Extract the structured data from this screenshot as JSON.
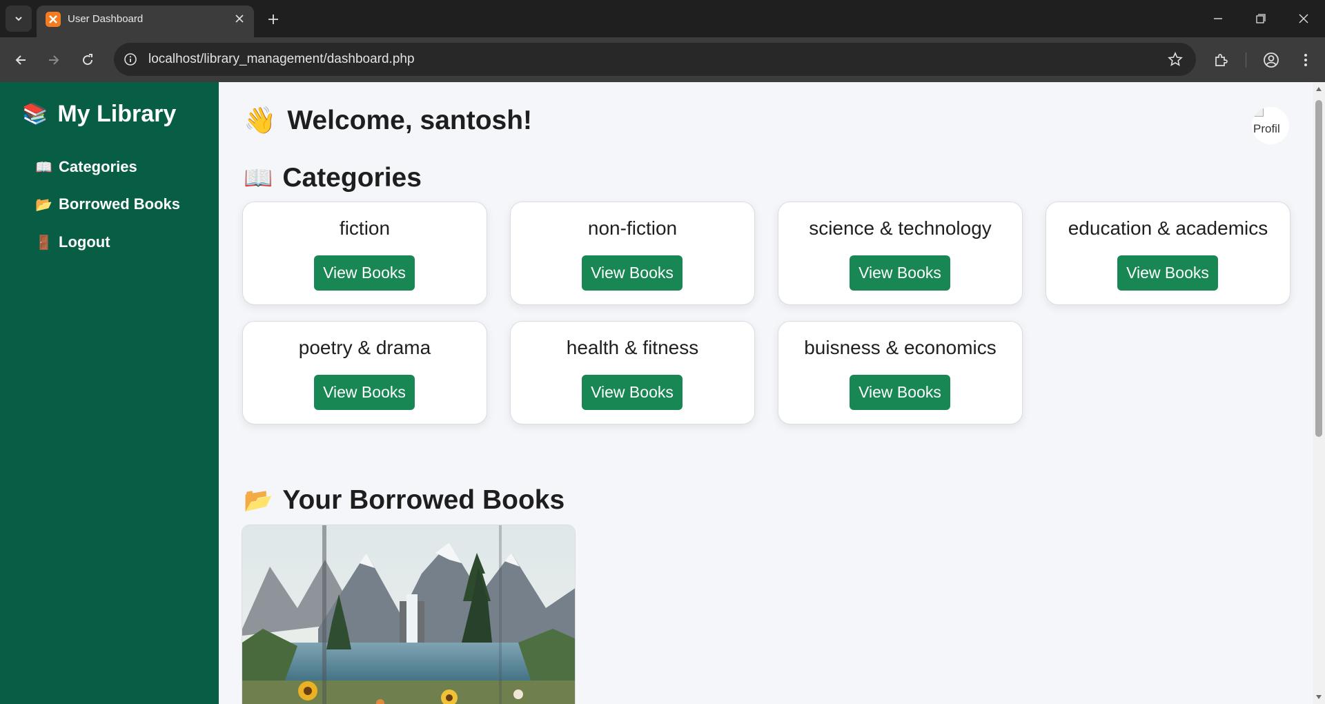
{
  "browser": {
    "tab_title": "User Dashboard",
    "url": "localhost/library_management/dashboard.php"
  },
  "sidebar": {
    "brand_icon": "📚",
    "brand": "My Library",
    "items": [
      {
        "icon": "📖",
        "label": "Categories"
      },
      {
        "icon": "📂",
        "label": "Borrowed Books"
      },
      {
        "icon": "🚪",
        "label": "Logout"
      }
    ]
  },
  "main": {
    "welcome_emoji": "👋",
    "welcome": "Welcome, santosh!",
    "profile_alt": "Profil",
    "categories_emoji": "📖",
    "categories_heading": "Categories",
    "categories": [
      {
        "name": "fiction",
        "button": "View Books"
      },
      {
        "name": "non-fiction",
        "button": "View Books"
      },
      {
        "name": "science & technology",
        "button": "View Books"
      },
      {
        "name": "education & academics",
        "button": "View Books"
      },
      {
        "name": "poetry & drama",
        "button": "View Books"
      },
      {
        "name": "health & fitness",
        "button": "View Books"
      },
      {
        "name": "buisness & economics",
        "button": "View Books"
      }
    ],
    "borrowed_emoji": "📂",
    "borrowed_heading": "Your Borrowed Books"
  },
  "colors": {
    "sidebar_bg": "#075e45",
    "button_bg": "#198754",
    "page_bg": "#f4f6f9"
  },
  "icons": [
    "tab-list-icon",
    "xampp-favicon-icon",
    "close-icon",
    "plus-icon",
    "minimize-icon",
    "restore-icon",
    "window-close-icon",
    "back-icon",
    "forward-icon",
    "reload-icon",
    "info-icon",
    "star-icon",
    "extensions-icon",
    "profile-icon",
    "menu-icon"
  ]
}
